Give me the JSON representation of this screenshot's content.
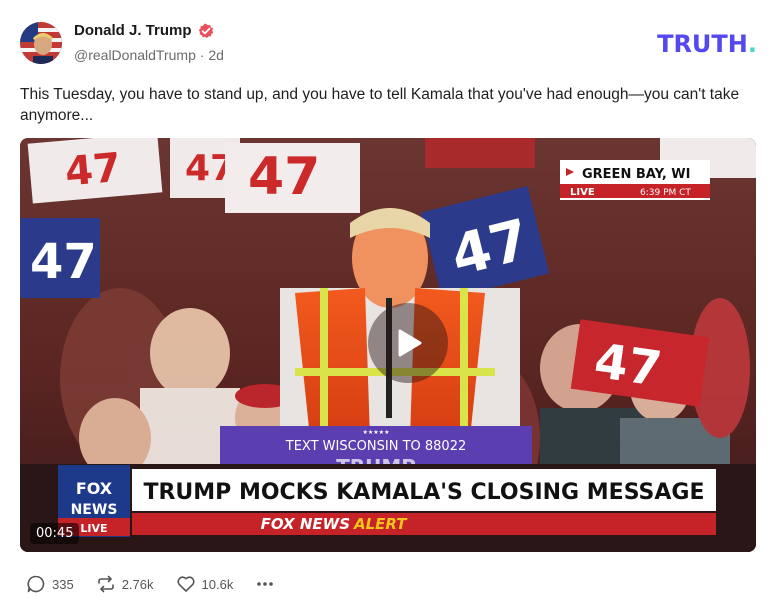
{
  "post": {
    "author_name": "Donald J. Trump",
    "handle": "@realDonaldTrump",
    "time_ago": "2d",
    "separator": "·",
    "text": "This Tuesday, you have to stand up, and you have to tell Kamala that you've had enough—you can't take anymore..."
  },
  "brand": {
    "logo_text": "TRUTH",
    "logo_dot": ".",
    "accent_color": "#5448ee",
    "dot_color": "#4fd3c4"
  },
  "video": {
    "duration": "00:45",
    "location": "GREEN BAY, WI",
    "live_label": "LIVE",
    "live_time": "6:39 PM CT",
    "ticker": "TEXT WISCONSIN TO 88022",
    "podium_text": "TRUMP",
    "network": "FOX NEWS",
    "fox_line1": "FOX",
    "fox_line2": "NEWS",
    "live_tag": "LIVE",
    "headline": "TRUMP MOCKS KAMALA'S CLOSING MESSAGE",
    "alert_network": "FOX NEWS",
    "alert_word": "ALERT",
    "sign_number": "47"
  },
  "actions": {
    "replies": "335",
    "retruths": "2.76k",
    "likes": "10.6k",
    "more_icon": "ellipsis-icon"
  }
}
